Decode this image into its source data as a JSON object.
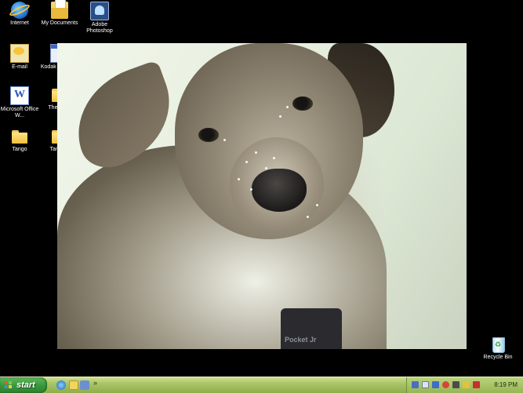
{
  "desktop": {
    "icons": [
      {
        "label": "Internet",
        "icon": "internet-explorer-icon"
      },
      {
        "label": "My Documents",
        "icon": "my-documents-icon"
      },
      {
        "label": "Adobe Photoshop",
        "icon": "photoshop-icon"
      },
      {
        "label": "E-mail",
        "icon": "email-icon"
      },
      {
        "label": "Kodak software",
        "icon": "kodak-software-icon"
      },
      {
        "label": "Microsoft Office W...",
        "icon": "word-icon"
      },
      {
        "label": "The dogs",
        "icon": "folder-icon"
      },
      {
        "label": "Tango",
        "icon": "folder-icon"
      },
      {
        "label": "Tango II",
        "icon": "folder-icon"
      },
      {
        "label": "Recycle Bin",
        "icon": "recycle-bin-icon"
      }
    ],
    "wallpaper": {
      "collar_text": "Pocket Jr"
    }
  },
  "taskbar": {
    "start_label": "start",
    "quick_launch": [
      "internet-explorer-icon",
      "outlook-icon",
      "show-desktop-icon"
    ],
    "overflow": "»",
    "tray_icons": [
      "network-icon",
      "monitor-icon",
      "help-icon",
      "security-icon",
      "volume-icon",
      "battery-icon",
      "antivirus-icon"
    ],
    "clock": "8:19 PM"
  },
  "colors": {
    "desktop_bg": "#000000",
    "taskbar": "#a9c467",
    "start_button": "#3a9a3d"
  }
}
